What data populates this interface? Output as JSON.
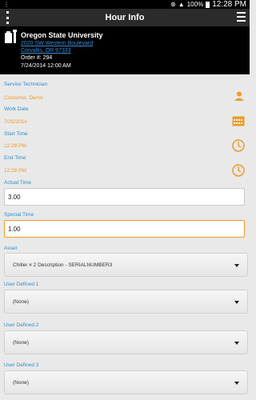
{
  "status_bar": {
    "left_icon": "notification-icon",
    "battery_percent": "100%",
    "time": "12:28 PM"
  },
  "action_bar": {
    "title": "Hour Info"
  },
  "customer": {
    "name": "Oregon State University",
    "address_line1": "2020 SW Western Boulevard",
    "address_line2": "Corvallis, OR 97333",
    "order": "Order #: 294",
    "date": "7/24/2014 12:00 AM"
  },
  "form": {
    "service_technician": {
      "label": "Service Technician",
      "value": "Customer, Demo"
    },
    "work_date": {
      "label": "Work Date",
      "value": "7/25/2014"
    },
    "start_time": {
      "label": "Start Time",
      "value": "12:28 PM"
    },
    "end_time": {
      "label": "End Time",
      "value": "12:28 PM"
    },
    "actual_time": {
      "label": "Actual Time",
      "value": "3.00"
    },
    "special_time": {
      "label": "Special Time",
      "value": "1.00"
    },
    "asset": {
      "label": "Asset",
      "value": "Chiller # 2 Description - SERIALNUMBER3"
    },
    "user_defined_1": {
      "label": "User Defined 1",
      "value": "(None)"
    },
    "user_defined_2": {
      "label": "User Defined 2",
      "value": "(None)"
    },
    "user_defined_3": {
      "label": "User Defined 3",
      "value": "(None)"
    }
  },
  "colors": {
    "label_blue": "#2f8ecc",
    "value_orange": "#f09a2a",
    "link_blue": "#3d8cd6",
    "focus_border": "#f39a2b"
  }
}
